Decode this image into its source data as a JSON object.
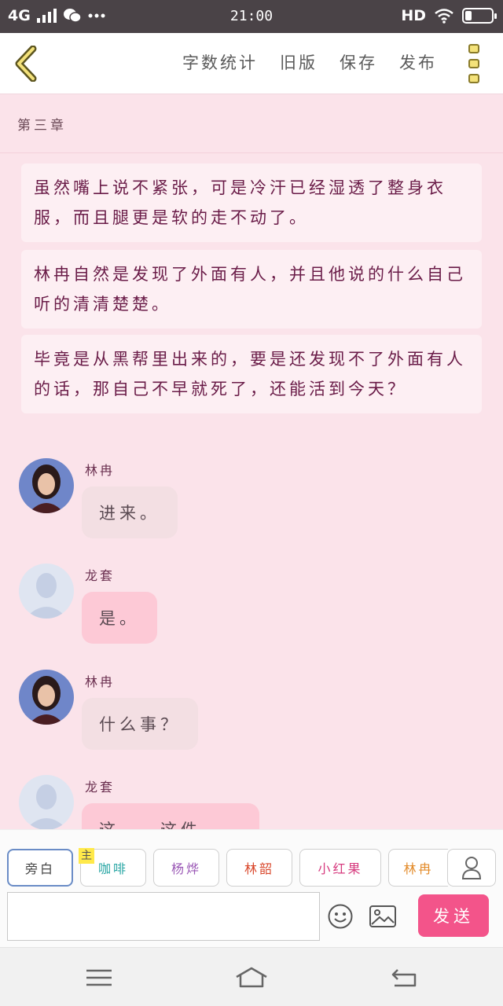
{
  "status_bar": {
    "network": "4G",
    "time": "21:00",
    "hd": "HD",
    "icons": [
      "signal-icon",
      "wechat-icon",
      "more-dots-icon",
      "wifi-icon",
      "battery-icon"
    ]
  },
  "toolbar": {
    "word_count": "字数统计",
    "old_version": "旧版",
    "save": "保存",
    "publish": "发布"
  },
  "chapter": {
    "title": "第三章"
  },
  "narration": [
    "虽然嘴上说不紧张，可是冷汗已经湿透了整身衣服，而且腿更是软的走不动了。",
    "林冉自然是发现了外面有人，并且他说的什么自己听的清清楚楚。",
    "毕竟是从黑帮里出来的，要是还发现不了外面有人的话，那自己不早就死了，还能活到今天？"
  ],
  "messages": [
    {
      "speaker": "林冉",
      "text": "进来。",
      "style": "grey"
    },
    {
      "speaker": "龙套",
      "text": "是。",
      "style": "pink"
    },
    {
      "speaker": "林冉",
      "text": "什么事？",
      "style": "grey"
    },
    {
      "speaker": "龙套",
      "text": "这……这件……",
      "style": "pink"
    }
  ],
  "input_panel": {
    "role_chips": [
      {
        "label": "旁白",
        "color": "#444444",
        "selected": true
      },
      {
        "label": "咖啡",
        "color": "#2aa7a5",
        "tag": "主"
      },
      {
        "label": "杨烨",
        "color": "#9b59b6"
      },
      {
        "label": "林韶",
        "color": "#d9472b"
      },
      {
        "label": "小红果",
        "color": "#d63a7e"
      },
      {
        "label": "林冉",
        "color": "#e38b2a"
      }
    ],
    "send_label": "发送"
  },
  "colors": {
    "background": "#fbe3ea",
    "send_button": "#f3548a",
    "narration_text": "#6a1c48"
  }
}
